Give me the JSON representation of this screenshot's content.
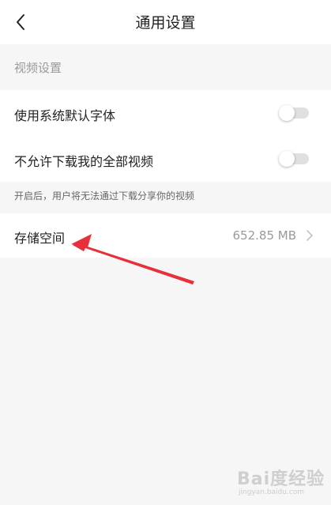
{
  "header": {
    "title": "通用设置",
    "back_icon": "chevron-left-icon"
  },
  "section": {
    "title": "视频设置"
  },
  "settings": [
    {
      "label": "使用系统默认字体",
      "enabled": false
    },
    {
      "label": "不允许下载我的全部视频",
      "enabled": false
    }
  ],
  "hint": {
    "text": "开启后，用户将无法通过下载分享你的视频"
  },
  "storage": {
    "label": "存储空间",
    "value": "652.85 MB",
    "icon": "chevron-right-icon"
  },
  "annotation": {
    "color": "#e8303a"
  },
  "watermark": {
    "logo": "Bai度经验",
    "sub": "jingyan.baidu.com"
  },
  "colors": {
    "background": "#f6f6f6",
    "card": "#ffffff",
    "secondary_text": "#9a9a9a",
    "toggle_track_off": "#e0e0e0"
  }
}
